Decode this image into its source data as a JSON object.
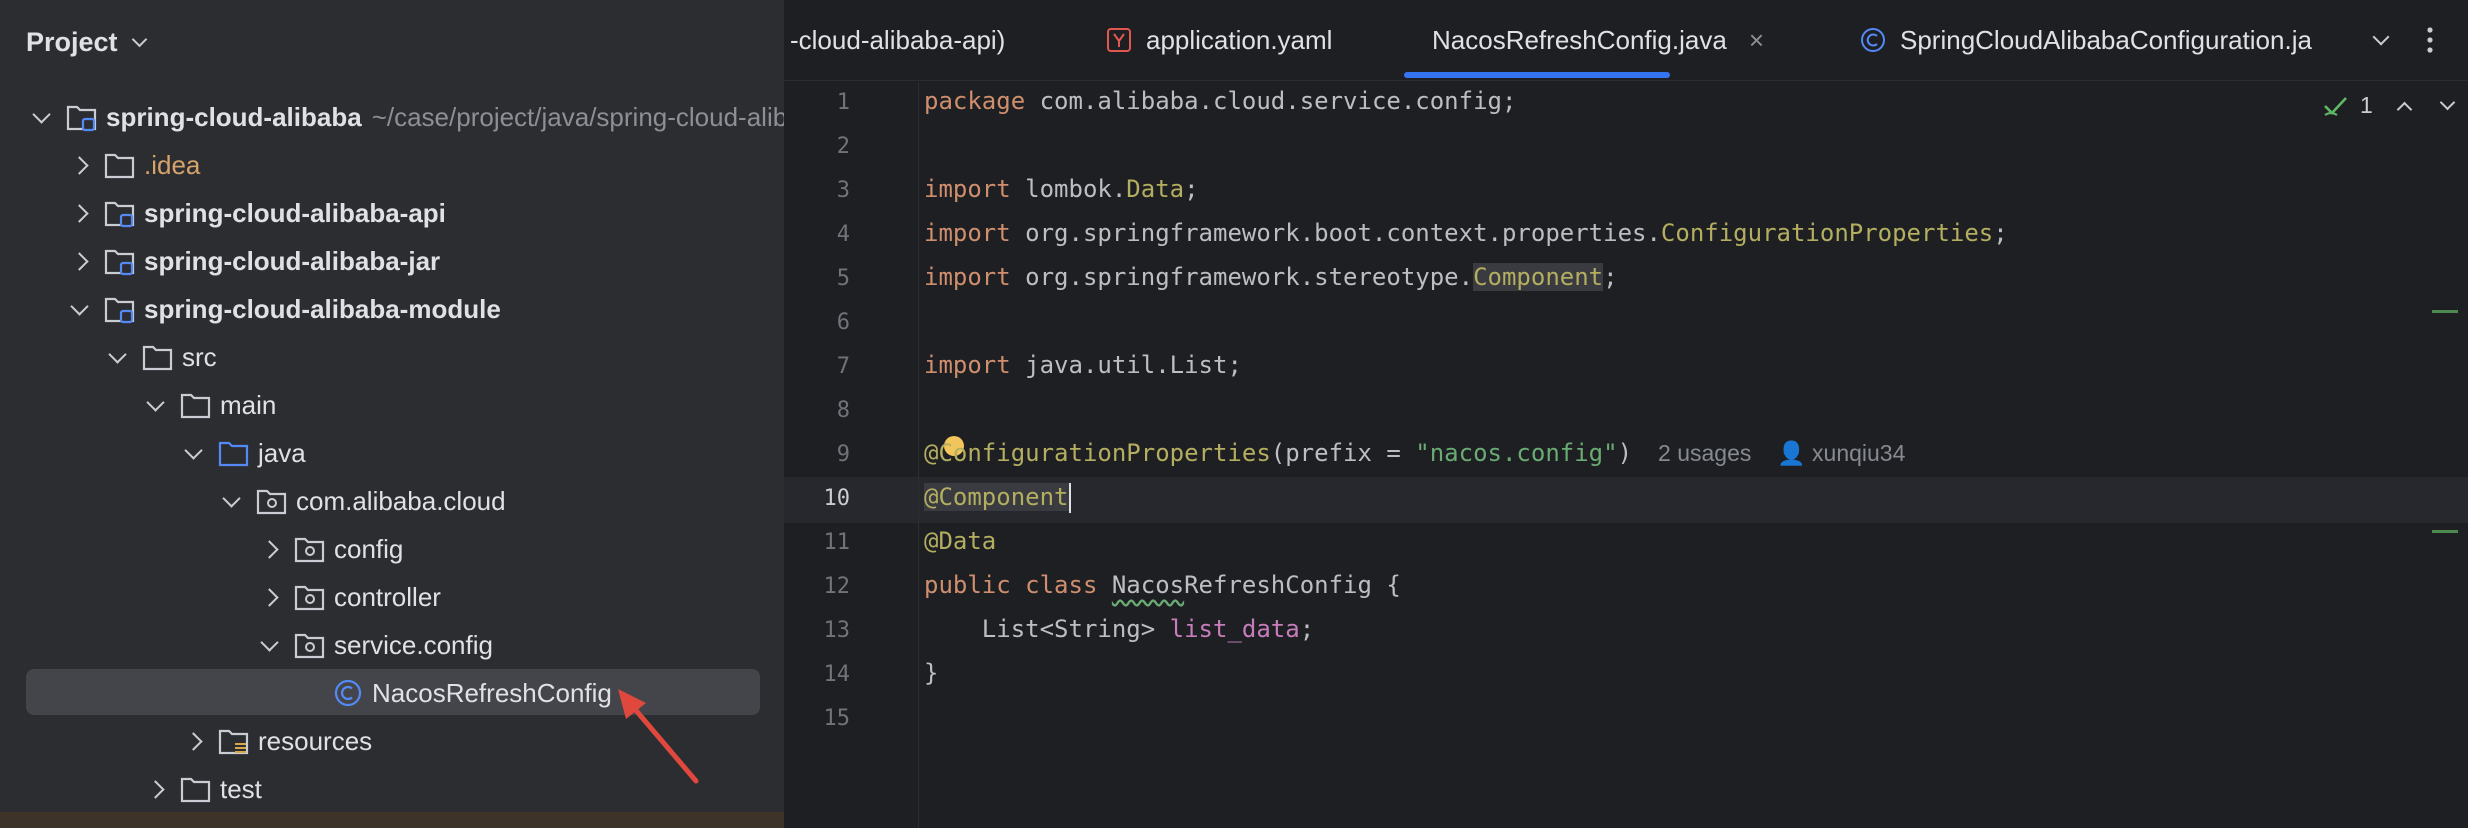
{
  "project_panel": {
    "title": "Project",
    "tree": [
      {
        "label": "spring-cloud-alibaba",
        "path": "~/case/project/java/spring-cloud-alibaba"
      },
      {
        "label": ".idea"
      },
      {
        "label": "spring-cloud-alibaba-api"
      },
      {
        "label": "spring-cloud-alibaba-jar"
      },
      {
        "label": "spring-cloud-alibaba-module"
      },
      {
        "label": "src"
      },
      {
        "label": "main"
      },
      {
        "label": "java"
      },
      {
        "label": "com.alibaba.cloud"
      },
      {
        "label": "config"
      },
      {
        "label": "controller"
      },
      {
        "label": "service.config"
      },
      {
        "label": "NacosRefreshConfig"
      },
      {
        "label": "resources"
      },
      {
        "label": "test"
      }
    ]
  },
  "tabs": [
    {
      "label": "-cloud-alibaba-api)"
    },
    {
      "label": "application.yaml",
      "icon": "yaml-icon"
    },
    {
      "label": "NacosRefreshConfig.java",
      "icon": "class-icon",
      "active": true
    },
    {
      "label": "SpringCloudAlibabaConfiguration.ja",
      "icon": "class-icon"
    }
  ],
  "editor": {
    "inspection_count": "1",
    "current_line": 10,
    "line_numbers": [
      "1",
      "2",
      "3",
      "4",
      "5",
      "6",
      "7",
      "8",
      "9",
      "10",
      "11",
      "12",
      "13",
      "14",
      "15"
    ],
    "code": {
      "l1_kw": "package",
      "l1_rest": " com.alibaba.cloud.service.config;",
      "l3_kw": "import",
      "l3_pkg": " lombok.",
      "l3_cls": "Data",
      "l3_end": ";",
      "l4_kw": "import",
      "l4_pkg": " org.springframework.boot.context.properties.",
      "l4_cls": "ConfigurationProperties",
      "l4_end": ";",
      "l5_kw": "import",
      "l5_pkg": " org.springframework.stereotype.",
      "l5_cls": "Component",
      "l5_end": ";",
      "l7_kw": "import",
      "l7_rest": " java.util.List;",
      "l9_ann": "@ConfigurationProperties",
      "l9_open": "(prefix = ",
      "l9_str": "\"nacos.config\"",
      "l9_close": ")",
      "l9_usages": "2 usages",
      "l9_author": "xunqiu34",
      "l10_ann": "@Component",
      "l11_ann": "@Data",
      "l12_kw1": "public",
      "l12_kw2": "class",
      "l12_name_a": "Nacos",
      "l12_name_b": "RefreshConfig {",
      "l13_type": "    List<String> ",
      "l13_field": "list_data",
      "l13_end": ";",
      "l14": "}"
    }
  },
  "colors": {
    "panel_bg": "#2b2d30",
    "editor_bg": "#1e1f22",
    "accent": "#3574f0",
    "arrow": "#e0483e"
  }
}
